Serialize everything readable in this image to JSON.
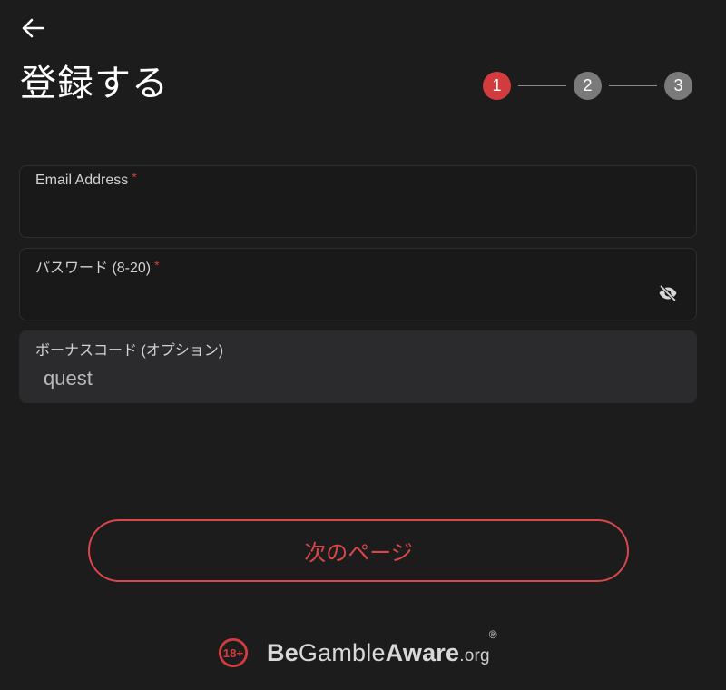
{
  "header": {
    "title": "登録する"
  },
  "stepper": {
    "steps": [
      "1",
      "2",
      "3"
    ],
    "active": 1
  },
  "form": {
    "email": {
      "label": "Email Address",
      "required_mark": "*",
      "value": ""
    },
    "password": {
      "label": "パスワード (8-20)",
      "required_mark": "*",
      "value": ""
    },
    "bonus_code": {
      "label": "ボーナスコード (オプション)",
      "value": "quest"
    }
  },
  "actions": {
    "next_label": "次のページ"
  },
  "footer": {
    "age_badge": "18+",
    "brand_be": "Be",
    "brand_gamble": "Gamble",
    "brand_aware": "Aware",
    "brand_org": ".org",
    "registered_mark": "®"
  },
  "icons": {
    "back": "arrow-left-icon",
    "password_toggle": "eye-off-icon",
    "age": "age-18-plus-icon"
  },
  "colors": {
    "background": "#1c1c1d",
    "accent": "#d23c3f",
    "inactive_step": "#7a7a7a",
    "field_filled": "#2b2b2d"
  }
}
